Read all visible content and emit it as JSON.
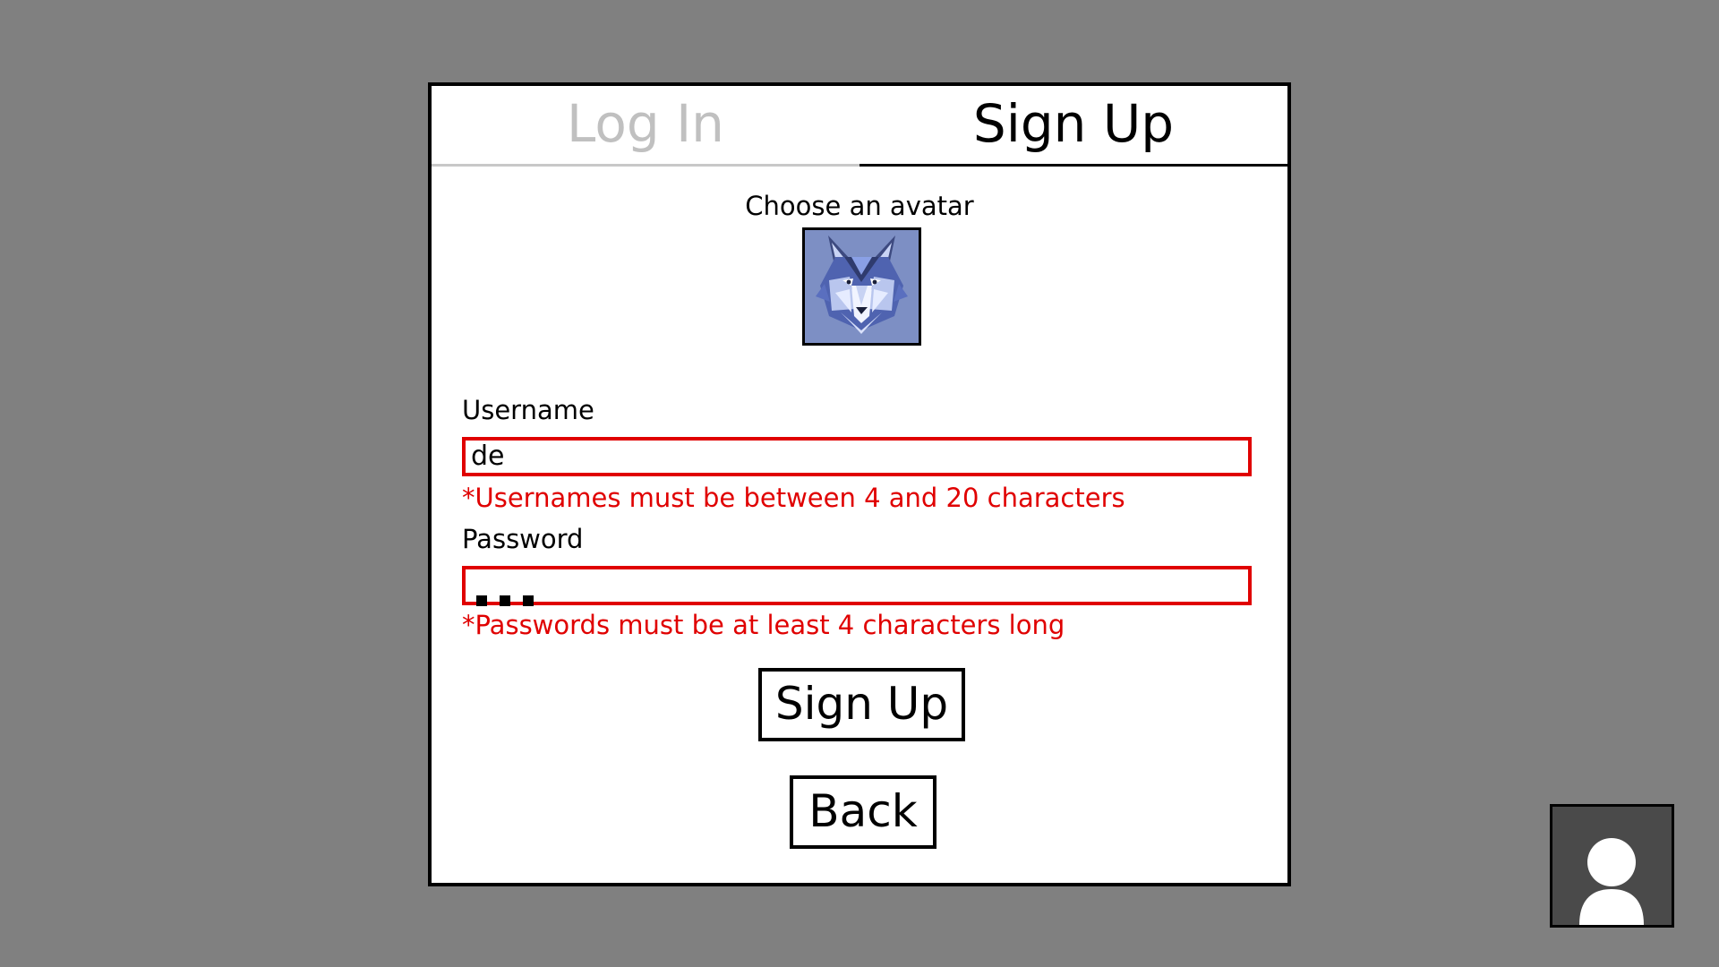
{
  "tabs": [
    {
      "label": "Log In",
      "active": false
    },
    {
      "label": "Sign Up",
      "active": true
    }
  ],
  "avatar": {
    "prompt": "Choose an avatar",
    "selected_icon": "wolf-avatar-icon",
    "background_color": "#7d8fc4"
  },
  "username": {
    "label": "Username",
    "value": "de",
    "error": "*Usernames must be between 4 and 20 characters"
  },
  "password": {
    "label": "Password",
    "masked_length": 3,
    "error": "*Passwords must be at least 4 characters long"
  },
  "buttons": {
    "submit_label": "Sign Up",
    "back_label": "Back"
  },
  "profile_button": {
    "icon": "user-silhouette-icon"
  },
  "colors": {
    "background": "#808080",
    "error": "#e00000",
    "inactive_tab": "#c0c0c0",
    "active_tab": "#000000"
  }
}
